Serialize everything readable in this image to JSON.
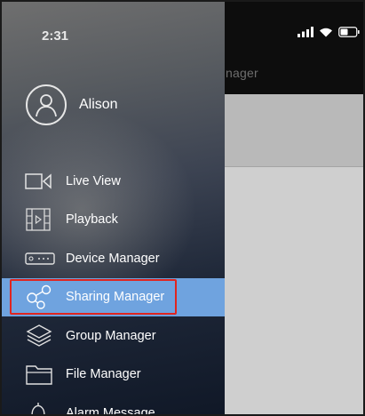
{
  "status_bar": {
    "time": "2:31",
    "signal_icon": "signal-bars-icon",
    "wifi_icon": "wifi-icon",
    "battery_icon": "battery-icon"
  },
  "background_screen": {
    "title_partial": "nager"
  },
  "profile": {
    "username": "Alison",
    "avatar_icon": "user-avatar-icon"
  },
  "menu": {
    "items": [
      {
        "label": "Live View",
        "icon": "camera-icon"
      },
      {
        "label": "Playback",
        "icon": "film-play-icon"
      },
      {
        "label": "Device Manager",
        "icon": "nvr-device-icon"
      },
      {
        "label": "Sharing Manager",
        "icon": "share-icon"
      },
      {
        "label": "Group Manager",
        "icon": "layers-icon"
      },
      {
        "label": "File Manager",
        "icon": "folder-icon"
      },
      {
        "label": "Alarm Message",
        "icon": "bell-icon"
      }
    ],
    "active_index": 3
  },
  "colors": {
    "active_item": "#6fa3df",
    "highlight_border": "#e0251f"
  }
}
